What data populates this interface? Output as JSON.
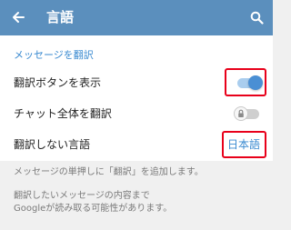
{
  "appbar": {
    "title": "言語",
    "back_icon": "arrow-left-icon",
    "search_icon": "search-icon",
    "background_color": "#5b8fbd"
  },
  "section": {
    "header": "メッセージを翻訳",
    "header_color": "#3a8ad0"
  },
  "settings": [
    {
      "label": "翻訳ボタンを表示",
      "control": "toggle",
      "state": "on"
    },
    {
      "label": "チャット全体を翻訳",
      "control": "toggle",
      "state": "locked-off"
    },
    {
      "label": "翻訳しない言語",
      "control": "value",
      "value": "日本語"
    }
  ],
  "footer": {
    "note1": "メッセージの単押しに「翻訳」を追加します。",
    "note2_line1": "翻訳したいメッセージの内容まで",
    "note2_line2": "Googleが読み取る可能性があります。"
  },
  "colors": {
    "accent": "#3a8ad0",
    "highlight": "#e8001a",
    "toggle_on": "#4a8fd4"
  }
}
